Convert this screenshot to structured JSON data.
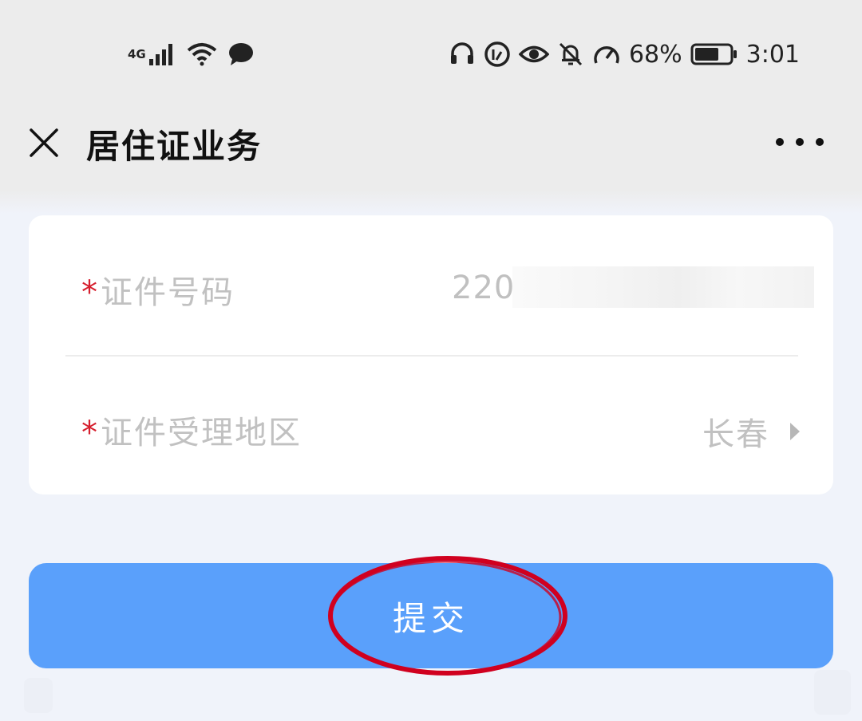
{
  "status_bar": {
    "network": "4G",
    "battery_percent": "68%",
    "battery_level": 0.68,
    "time": "3:01",
    "icons": [
      "signal-icon",
      "wifi-icon",
      "message-icon",
      "headset-icon",
      "data-saver-icon",
      "eye-icon",
      "bell-off-icon",
      "speed-icon",
      "battery-icon"
    ]
  },
  "nav": {
    "title": "居住证业务",
    "close_icon": "close-icon",
    "more_icon": "more-icon"
  },
  "form": {
    "id_number": {
      "required_mark": "*",
      "label": "证件号码",
      "value": "220"
    },
    "region": {
      "required_mark": "*",
      "label": "证件受理地区",
      "value": "长春",
      "arrow_icon": "chevron-right-icon"
    }
  },
  "submit": {
    "label": "提交"
  },
  "colors": {
    "primary": "#5aa0fb",
    "required": "#d61f2e",
    "annotation": "#d0001f",
    "background": "#f0f3fa"
  }
}
